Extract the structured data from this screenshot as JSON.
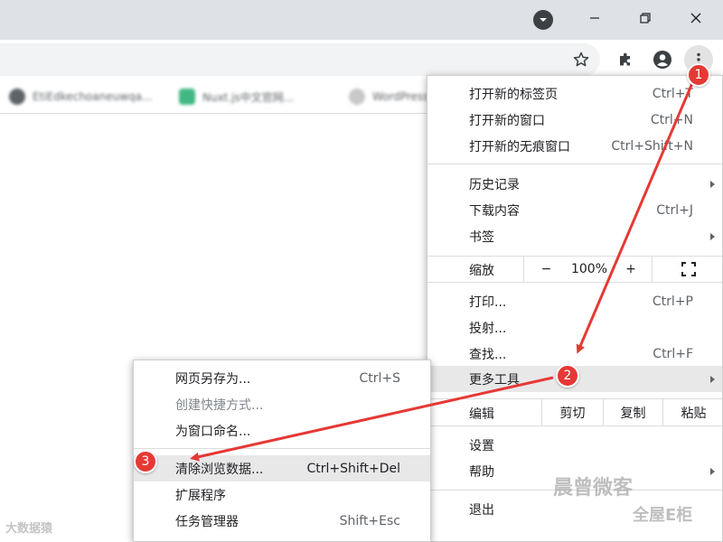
{
  "window": {
    "minimize_glyph": "—",
    "maximize_glyph": "❐",
    "close_glyph": "✕"
  },
  "toolbar": {
    "icons": [
      "bookmark-star-icon",
      "extensions-icon",
      "profile-icon",
      "more-menu-icon"
    ]
  },
  "bookmarks": [
    {
      "label": "EtiEdkechoaneuwqa...",
      "favicon": "github-icon",
      "color": "#5f6368"
    },
    {
      "label": "Nuxt.js中文官网...",
      "favicon": "nuxt-icon",
      "color": "#41b883"
    },
    {
      "label": "WordPress",
      "favicon": "wordpress-icon",
      "color": "#a0a0a0"
    }
  ],
  "main_menu": {
    "new_tab": {
      "label": "打开新的标签页",
      "shortcut": "Ctrl+T"
    },
    "new_window": {
      "label": "打开新的窗口",
      "shortcut": "Ctrl+N"
    },
    "new_incognito": {
      "label": "打开新的无痕窗口",
      "shortcut": "Ctrl+Shift+N"
    },
    "history": {
      "label": "历史记录"
    },
    "downloads": {
      "label": "下载内容",
      "shortcut": "Ctrl+J"
    },
    "bookmarks": {
      "label": "书签"
    },
    "zoom": {
      "label": "缩放",
      "minus": "−",
      "value": "100%",
      "plus": "+"
    },
    "print": {
      "label": "打印...",
      "shortcut": "Ctrl+P"
    },
    "cast": {
      "label": "投射..."
    },
    "find": {
      "label": "查找...",
      "shortcut": "Ctrl+F"
    },
    "more_tools": {
      "label": "更多工具"
    },
    "edit": {
      "label": "编辑",
      "cut": "剪切",
      "copy": "复制",
      "paste": "粘贴"
    },
    "settings": {
      "label": "设置"
    },
    "help": {
      "label": "帮助"
    },
    "exit": {
      "label": "退出"
    }
  },
  "sub_menu": {
    "save_page": {
      "label": "网页另存为...",
      "shortcut": "Ctrl+S"
    },
    "create_shortcut": {
      "label": "创建快捷方式..."
    },
    "name_window": {
      "label": "为窗口命名..."
    },
    "clear_data": {
      "label": "清除浏览数据...",
      "shortcut": "Ctrl+Shift+Del"
    },
    "extensions": {
      "label": "扩展程序"
    },
    "task_manager": {
      "label": "任务管理器",
      "shortcut": "Shift+Esc"
    }
  },
  "markers": {
    "step1": "1",
    "step2": "2",
    "step3": "3"
  },
  "colors": {
    "marker": "#e53935",
    "arrow": "#e53935"
  },
  "watermarks": {
    "left": "大数据猿",
    "right_top": "晨曾微客",
    "right_bottom": "全屋E柜"
  }
}
